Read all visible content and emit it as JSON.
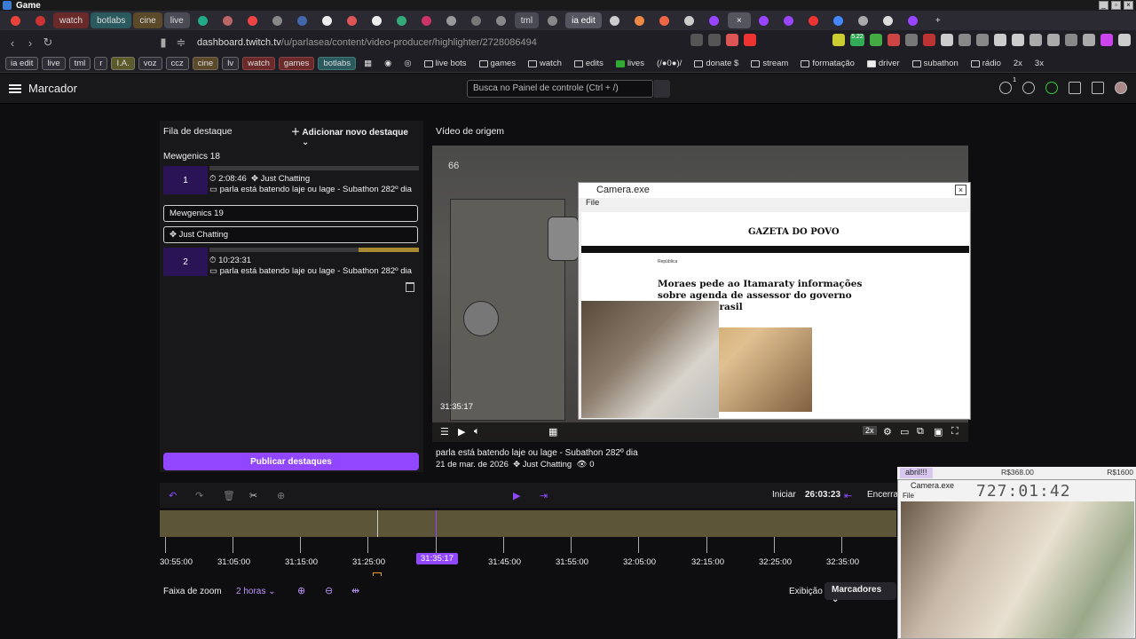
{
  "os": {
    "window_title": "Game"
  },
  "browser": {
    "tabs": [
      {
        "label": "watch",
        "style": "red"
      },
      {
        "label": "botlabs",
        "style": "teal"
      },
      {
        "label": "cine",
        "style": "olive"
      },
      {
        "label": "live",
        "style": "gray"
      },
      {
        "label": "tml",
        "style": "gray"
      },
      {
        "label": "ia edit",
        "style": "active"
      }
    ],
    "url_host": "dashboard.twitch.tv",
    "url_path": "/u/parlasea/content/video-producer/highlighter/2728086494",
    "extension_badge": "5.22",
    "bookmarks": [
      {
        "label": "ia edit",
        "style": "box"
      },
      {
        "label": "live",
        "style": "box"
      },
      {
        "label": "tml",
        "style": "box"
      },
      {
        "label": "r",
        "style": "box"
      },
      {
        "label": "I.A.",
        "style": "yellow"
      },
      {
        "label": "voz",
        "style": "box"
      },
      {
        "label": "ccz",
        "style": "box"
      },
      {
        "label": "cine",
        "style": "olive"
      },
      {
        "label": "lv",
        "style": "box"
      },
      {
        "label": "watch",
        "style": "red"
      },
      {
        "label": "games",
        "style": "red"
      },
      {
        "label": "botlabs",
        "style": "teal"
      }
    ],
    "folders": [
      "live bots",
      "games",
      "watch",
      "edits",
      "lives",
      "(/●0●)/",
      "donate $",
      "stream",
      "formatação",
      "driver",
      "subathon",
      "rádio",
      "2x",
      "3x"
    ]
  },
  "twitch": {
    "page_title": "Marcador",
    "search_placeholder": "Busca no Painel de controle (Ctrl + /)",
    "notification_count": "1"
  },
  "queue": {
    "title": "Fila de destaque",
    "add_button": "Adicionar novo destaque",
    "groups": [
      {
        "name": "Mewgenics 18",
        "number": "1",
        "time": "2:08:46",
        "category": "Just Chatting",
        "title": "parla está batendo laje ou lage - Subathon 282º dia"
      },
      {
        "name": "Mewgenics 19",
        "category_field": "Just Chatting",
        "number": "2",
        "time": "10:23:31",
        "title": "parla está batendo laje ou lage - Subathon 282º dia"
      }
    ],
    "publish_button": "Publicar destaques"
  },
  "source": {
    "title": "Vídeo de origem",
    "video_time": "31:35:17",
    "speed": "2x",
    "stream_title": "parla está batendo laje ou lage - Subathon 282º dia",
    "date": "21 de mar. de 2026",
    "category": "Just Chatting",
    "views": "0",
    "game_counter": "66"
  },
  "camera_window": {
    "title": "Camera.exe",
    "menu": "File",
    "site_name": "GAZETA DO POVO",
    "section": "República",
    "headline": "Moraes pede ao Itamaraty informações sobre agenda de assessor do governo Trump no Brasil"
  },
  "timeline": {
    "start_label": "Iniciar",
    "start_value": "26:03:23",
    "end_label": "Encerrar",
    "ticks": [
      "30:55:00",
      "31:05:00",
      "31:15:00",
      "31:25:00",
      "31:45:00",
      "31:55:00",
      "32:05:00",
      "32:15:00",
      "32:25:00",
      "32:35:00"
    ],
    "playhead": "31:35:17",
    "zoom_label": "Faixa de zoom",
    "zoom_value": "2 horas",
    "view_label": "Exibição",
    "markers_label": "Marcadores"
  },
  "overlay": {
    "label_a": "abril!!!",
    "label_b": "R$368.00",
    "label_c": "R$1600",
    "cam_title": "Camera.exe",
    "cam_menu": "File",
    "timer": "727:01:42"
  }
}
